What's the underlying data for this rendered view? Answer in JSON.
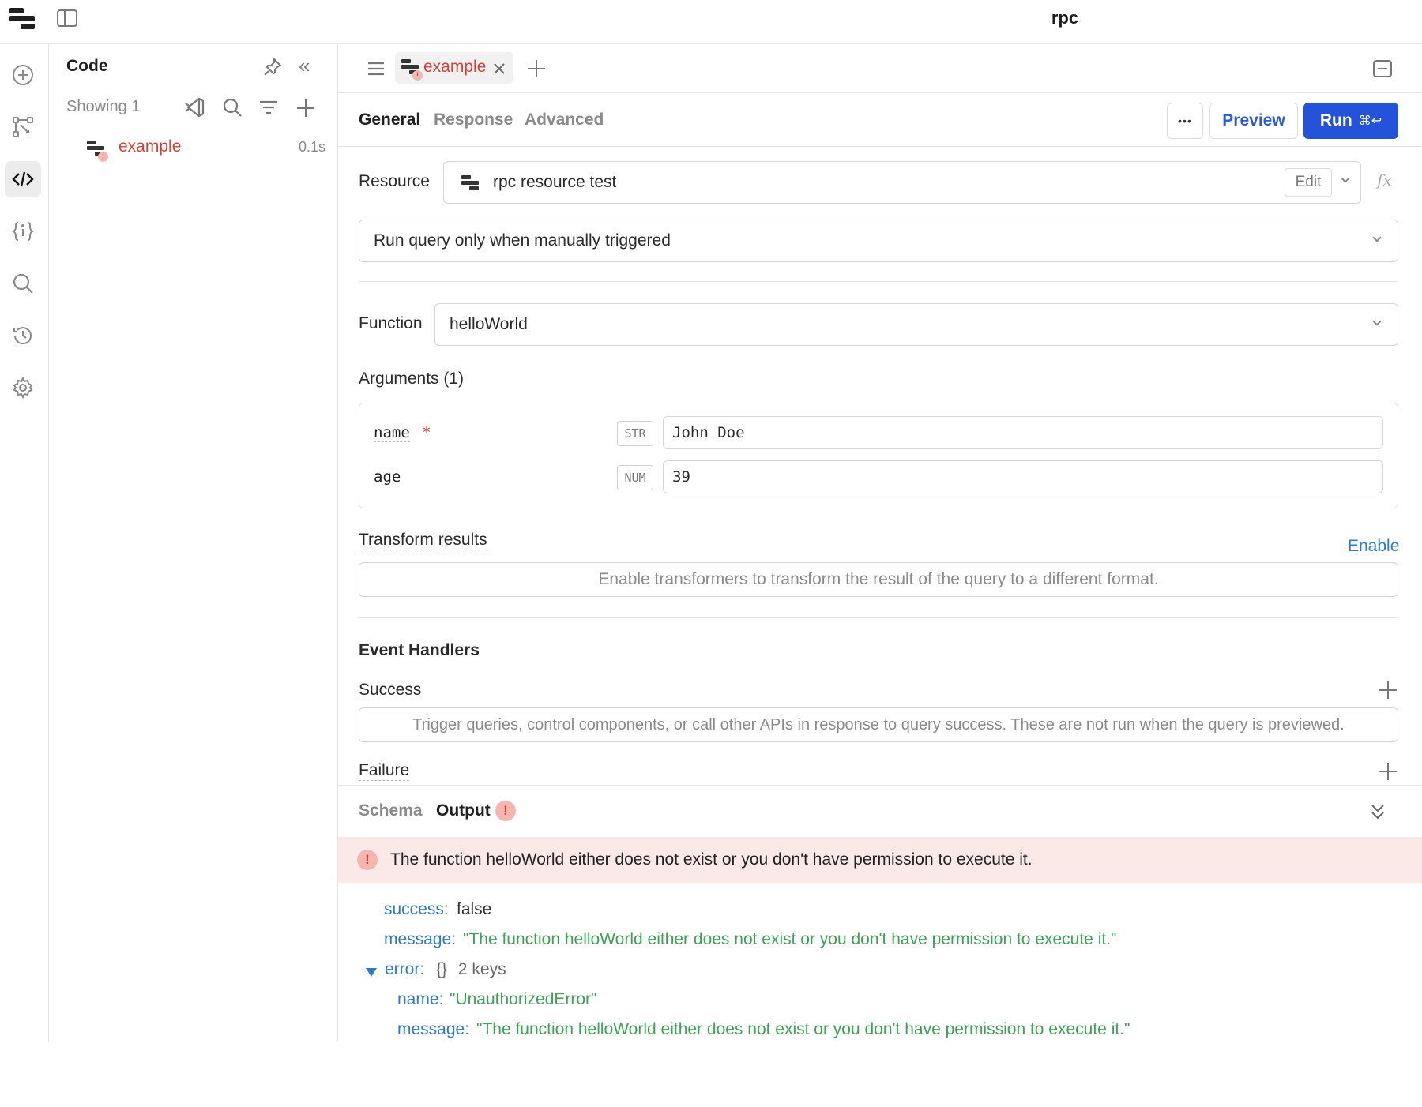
{
  "app": {
    "title": "rpc"
  },
  "rail": {
    "items": [
      {
        "name": "add",
        "icon": "plus-circle-icon"
      },
      {
        "name": "workflow",
        "icon": "workflow-icon"
      },
      {
        "name": "code",
        "icon": "code-icon",
        "active": true
      },
      {
        "name": "state",
        "icon": "braces-info-icon"
      },
      {
        "name": "search",
        "icon": "search-icon"
      },
      {
        "name": "history",
        "icon": "history-icon"
      },
      {
        "name": "settings",
        "icon": "gear-icon"
      }
    ]
  },
  "code_panel": {
    "title": "Code",
    "showing": "Showing 1",
    "queries": [
      {
        "name": "example",
        "time": "0.1s",
        "status": "error"
      }
    ]
  },
  "editor": {
    "tab": {
      "label": "example"
    },
    "subtabs": [
      "General",
      "Response",
      "Advanced"
    ],
    "active_subtab": "General",
    "actions": {
      "more": "•••",
      "preview": "Preview",
      "run": "Run",
      "run_shortcut": "⌘↩"
    },
    "resource": {
      "label": "Resource",
      "value": "rpc resource test",
      "edit": "Edit",
      "fx": "fx"
    },
    "trigger": {
      "value": "Run query only when manually triggered"
    },
    "function": {
      "label": "Function",
      "value": "helloWorld"
    },
    "arguments": {
      "title": "Arguments (1)",
      "items": [
        {
          "name": "name",
          "required_mark": "*",
          "type": "STR",
          "value": "John Doe"
        },
        {
          "name": "age",
          "required_mark": "",
          "type": "NUM",
          "value": "39"
        }
      ]
    },
    "transform": {
      "title": "Transform results",
      "enable": "Enable",
      "placeholder": "Enable transformers to transform the result of the query to a different format."
    },
    "event_handlers": {
      "title": "Event Handlers",
      "success": {
        "title": "Success",
        "placeholder": "Trigger queries, control components, or call other APIs in response to query success. These are not run when the query is previewed."
      },
      "failure": {
        "title": "Failure"
      }
    },
    "output": {
      "tabs": [
        "Schema",
        "Output"
      ],
      "active_tab": "Output",
      "error_badge": "!",
      "error_message": "The function helloWorld either does not exist or you don't have permission to execute it.",
      "json": {
        "success_key": "success:",
        "success_val": "false",
        "message_key": "message:",
        "message_val": "\"The function helloWorld either does not exist or you don't have permission to execute it.\"",
        "error_key": "error:",
        "error_meta_braces": "{}",
        "error_meta_count": "2 keys",
        "error_name_key": "name:",
        "error_name_val": "\"UnauthorizedError\"",
        "error_message_key": "message:",
        "error_message_val": "\"The function helloWorld either does not exist or you don't have permission to execute it.\""
      }
    }
  },
  "colors": {
    "accent": "#2452d8",
    "error": "#d0433b",
    "string": "#3aa356",
    "key": "#2e7bc4"
  }
}
